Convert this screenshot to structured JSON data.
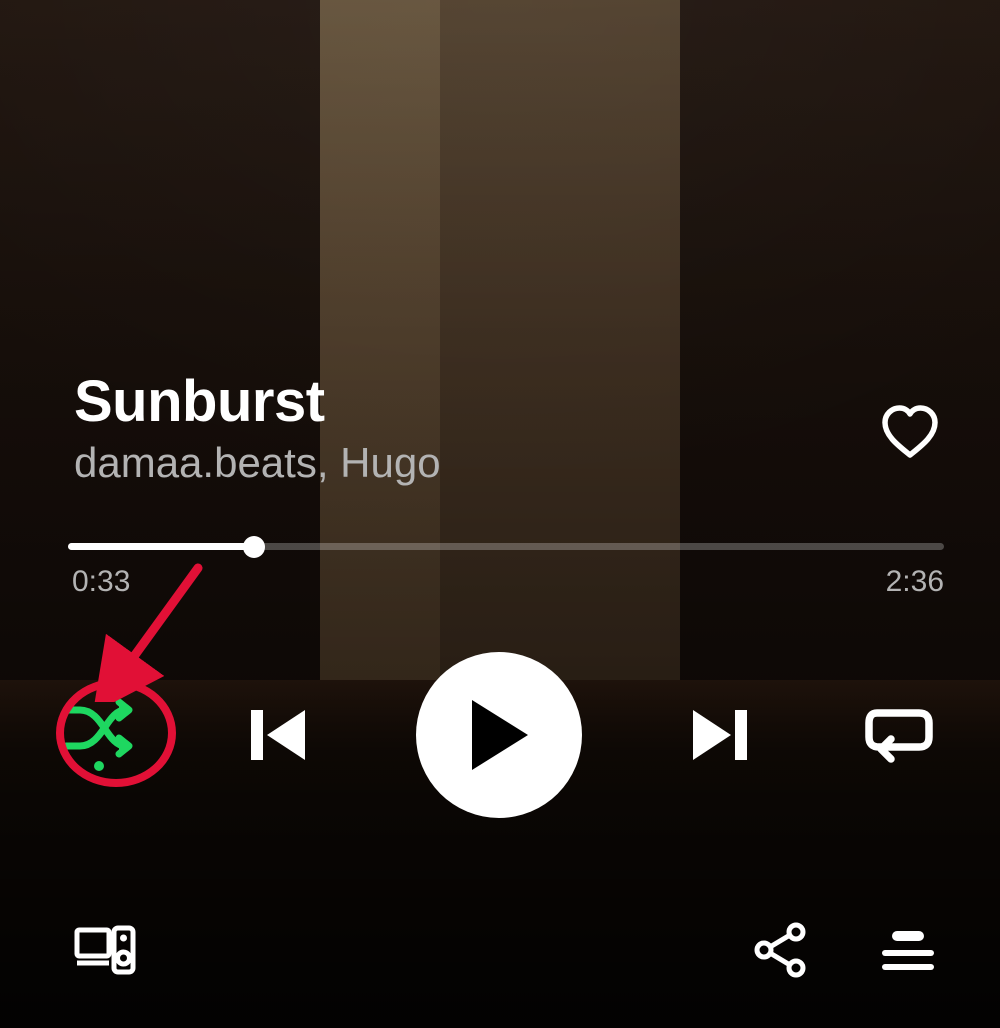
{
  "track": {
    "title": "Sunburst",
    "artist": "damaa.beats, Hugo"
  },
  "playback": {
    "elapsed": "0:33",
    "total": "2:36",
    "progress_percent": 21.2,
    "shuffle_on": true,
    "repeat_mode": "all",
    "is_playing": false,
    "liked": false
  },
  "icons": {
    "heart": "heart-icon",
    "shuffle": "shuffle-icon",
    "previous": "previous-icon",
    "play": "play-icon",
    "next": "next-icon",
    "repeat": "repeat-icon",
    "devices": "devices-icon",
    "share": "share-icon",
    "queue": "queue-icon"
  },
  "colors": {
    "accent": "#1ed760",
    "annotation": "#e11036",
    "text_secondary": "#b3b3b3"
  },
  "annotation": {
    "target": "shuffle-button"
  }
}
